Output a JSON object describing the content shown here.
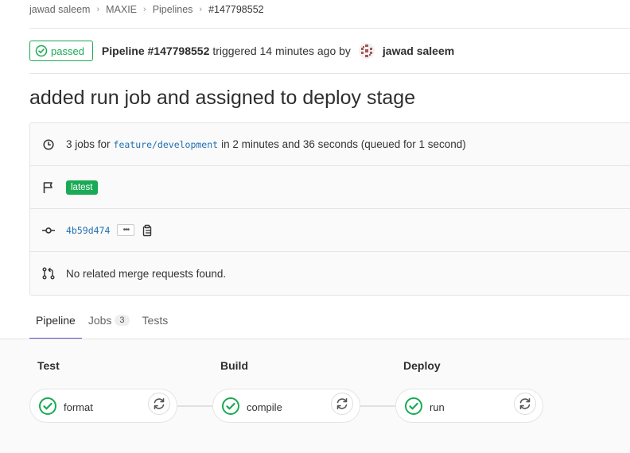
{
  "breadcrumb": [
    "jawad saleem",
    "MAXIE",
    "Pipelines",
    "#147798552"
  ],
  "header": {
    "status": "passed",
    "pipeline_label": "Pipeline #147798552",
    "triggered_text": "triggered 14 minutes ago by",
    "author": "jawad saleem"
  },
  "commit_title": "added run job and assigned to deploy stage",
  "info": {
    "jobs_prefix": "3 jobs for",
    "branch": "feature/development",
    "jobs_suffix": "in 2 minutes and 36 seconds (queued for 1 second)",
    "tag": "latest",
    "sha": "4b59d474",
    "ellipsis": "•••",
    "merge_requests": "No related merge requests found."
  },
  "tabs": [
    {
      "label": "Pipeline"
    },
    {
      "label": "Jobs",
      "count": "3"
    },
    {
      "label": "Tests"
    }
  ],
  "stages": [
    {
      "title": "Test",
      "job": "format"
    },
    {
      "title": "Build",
      "job": "compile"
    },
    {
      "title": "Deploy",
      "job": "run"
    }
  ],
  "colors": {
    "success": "#1aaa55",
    "active_tab": "#6b4fbb"
  }
}
